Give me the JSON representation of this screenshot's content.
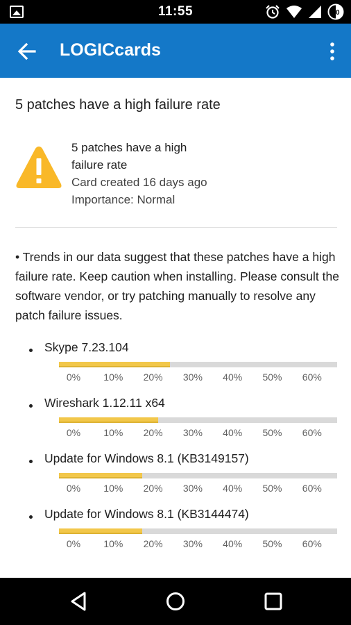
{
  "status_bar": {
    "time": "11:55",
    "battery_level": "40"
  },
  "app_bar": {
    "title": "LOGICcards"
  },
  "card": {
    "page_title": "5 patches have a high failure rate",
    "headline": "5 patches have a high failure rate",
    "created": "Card created 16 days ago",
    "importance": "Importance: Normal",
    "description": "• Trends in our data suggest that these patches have a high failure rate. Keep caution when installing. Please consult the software vendor, or try patching manually to resolve any patch failure issues."
  },
  "axis_ticks": [
    "0%",
    "10%",
    "20%",
    "30%",
    "40%",
    "50%",
    "60%"
  ],
  "patches": [
    {
      "name": "Skype 7.23.104",
      "failure_rate": 0.28
    },
    {
      "name": "Wireshark 1.12.11 x64",
      "failure_rate": 0.25
    },
    {
      "name": "Update for Windows 8.1 (KB3149157)",
      "failure_rate": 0.21
    },
    {
      "name": "Update for Windows 8.1 (KB3144474)",
      "failure_rate": 0.21
    }
  ],
  "colors": {
    "app_bar": "#1478c8",
    "warning": "#f9b828",
    "bar_fill": "#f2c74a",
    "bar_track": "#d9d9d9"
  },
  "icons": [
    "image-icon",
    "alarm-icon",
    "wifi-icon",
    "signal-icon",
    "battery-icon",
    "back-arrow-icon",
    "overflow-menu-icon",
    "warning-icon",
    "nav-back-icon",
    "nav-home-icon",
    "nav-recents-icon"
  ]
}
